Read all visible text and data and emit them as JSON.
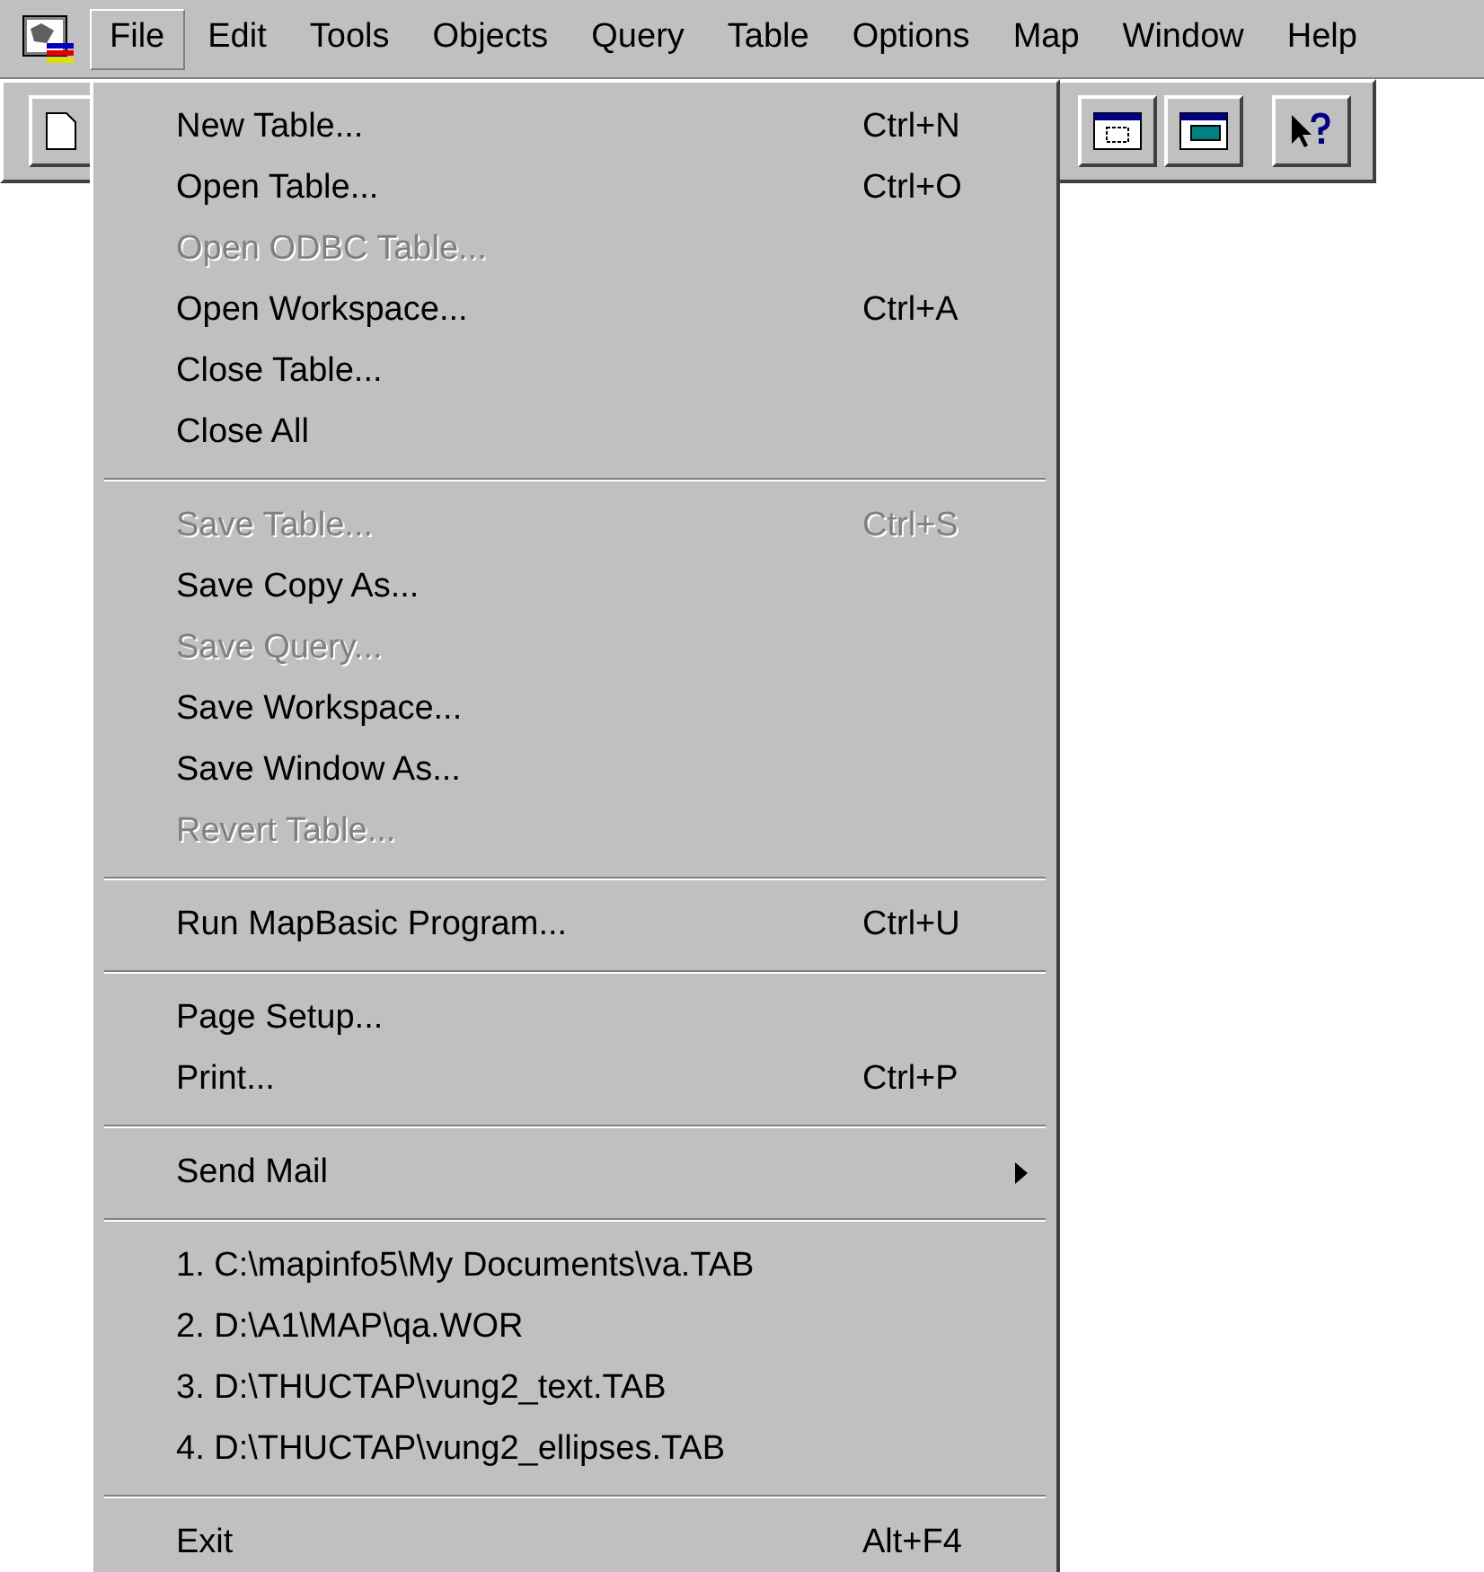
{
  "menu_bar": [
    {
      "label": "File",
      "selected": true
    },
    {
      "label": "Edit",
      "selected": false
    },
    {
      "label": "Tools",
      "selected": false
    },
    {
      "label": "Objects",
      "selected": false
    },
    {
      "label": "Query",
      "selected": false
    },
    {
      "label": "Table",
      "selected": false
    },
    {
      "label": "Options",
      "selected": false
    },
    {
      "label": "Map",
      "selected": false
    },
    {
      "label": "Window",
      "selected": false
    },
    {
      "label": "Help",
      "selected": false
    }
  ],
  "file_menu": [
    {
      "kind": "item",
      "label": "New Table...",
      "shortcut": "Ctrl+N",
      "disabled": false
    },
    {
      "kind": "item",
      "label": "Open Table...",
      "shortcut": "Ctrl+O",
      "disabled": false
    },
    {
      "kind": "item",
      "label": "Open ODBC Table...",
      "disabled": true
    },
    {
      "kind": "item",
      "label": "Open Workspace...",
      "shortcut": "Ctrl+A",
      "disabled": false
    },
    {
      "kind": "item",
      "label": "Close Table...",
      "disabled": false
    },
    {
      "kind": "item",
      "label": "Close All",
      "disabled": false
    },
    {
      "kind": "separator"
    },
    {
      "kind": "item",
      "label": "Save Table...",
      "shortcut": "Ctrl+S",
      "disabled": true
    },
    {
      "kind": "item",
      "label": "Save Copy As...",
      "disabled": false
    },
    {
      "kind": "item",
      "label": "Save Query...",
      "disabled": true
    },
    {
      "kind": "item",
      "label": "Save Workspace...",
      "disabled": false
    },
    {
      "kind": "item",
      "label": "Save Window As...",
      "disabled": false
    },
    {
      "kind": "item",
      "label": "Revert Table...",
      "disabled": true
    },
    {
      "kind": "separator"
    },
    {
      "kind": "item",
      "label": "Run MapBasic Program...",
      "shortcut": "Ctrl+U",
      "disabled": false
    },
    {
      "kind": "separator"
    },
    {
      "kind": "item",
      "label": "Page Setup...",
      "disabled": false
    },
    {
      "kind": "item",
      "label": "Print...",
      "shortcut": "Ctrl+P",
      "disabled": false
    },
    {
      "kind": "separator"
    },
    {
      "kind": "submenu",
      "label": "Send Mail",
      "disabled": false
    },
    {
      "kind": "separator"
    },
    {
      "kind": "item",
      "label": "1. C:\\mapinfo5\\My Documents\\va.TAB",
      "disabled": false
    },
    {
      "kind": "item",
      "label": "2. D:\\A1\\MAP\\qa.WOR",
      "disabled": false
    },
    {
      "kind": "item",
      "label": "3. D:\\THUCTAP\\vung2_text.TAB",
      "disabled": false
    },
    {
      "kind": "item",
      "label": "4. D:\\THUCTAP\\vung2_ellipses.TAB",
      "disabled": false
    },
    {
      "kind": "separator"
    },
    {
      "kind": "item",
      "label": "Exit",
      "shortcut": "Alt+F4",
      "disabled": false
    }
  ]
}
